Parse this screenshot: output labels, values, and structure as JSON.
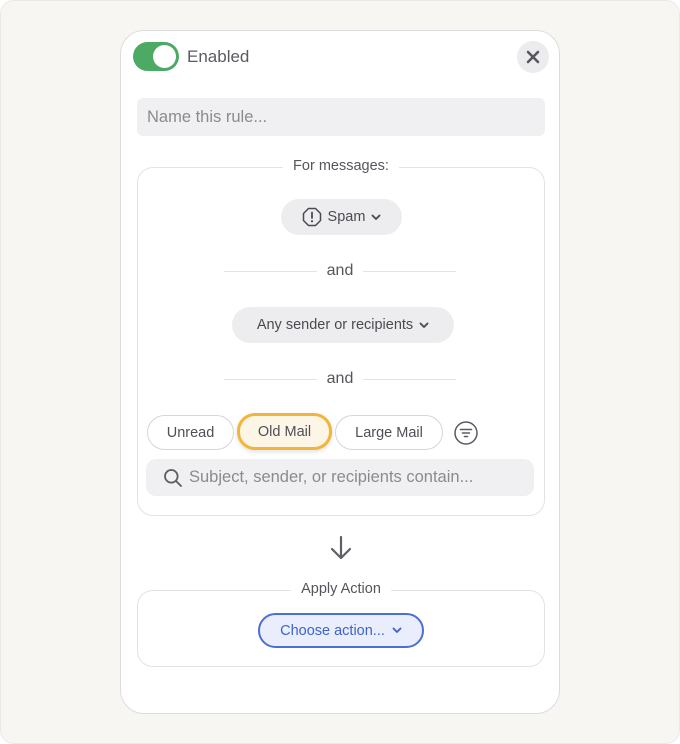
{
  "header": {
    "enabled_toggle": {
      "on": true,
      "label": "Enabled"
    },
    "close_icon": "close-icon"
  },
  "rule_name": {
    "value": "",
    "placeholder": "Name this rule..."
  },
  "conditions": {
    "legend": "For messages:",
    "category_dropdown": {
      "icon": "spam-octagon-icon",
      "label": "Spam"
    },
    "connector_1": "and",
    "sender_dropdown": {
      "label": "Any sender or recipients"
    },
    "connector_2": "and",
    "chips": [
      {
        "label": "Unread",
        "active": false
      },
      {
        "label": "Old Mail",
        "active": true
      },
      {
        "label": "Large Mail",
        "active": false
      }
    ],
    "filter_icon": "filter-icon",
    "search": {
      "value": "",
      "placeholder": "Subject, sender, or recipients contain..."
    }
  },
  "flow_icon": "arrow-down-icon",
  "action": {
    "legend": "Apply Action",
    "choose_label": "Choose action..."
  },
  "colors": {
    "toggle_on": "#4caa64",
    "active_chip_border": "#f2b43a",
    "active_chip_bg": "#fdf5e6",
    "action_accent": "#4b6fd6",
    "action_bg": "#eaedfb",
    "page_bg": "#f7f6f2"
  }
}
